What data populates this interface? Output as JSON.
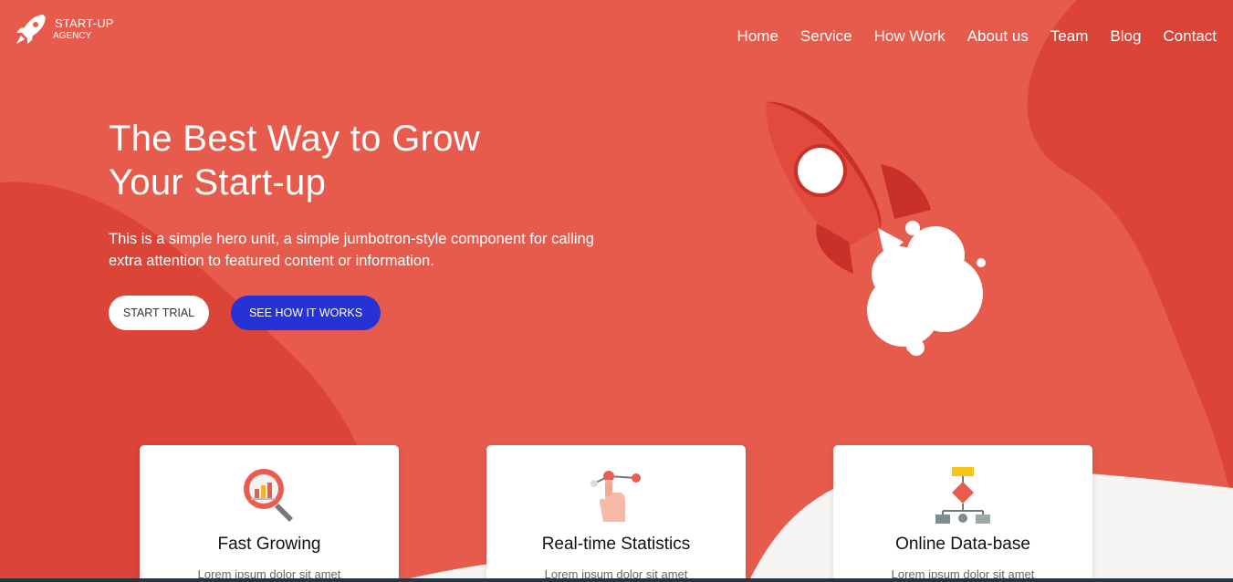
{
  "brand": {
    "title": "START-UP",
    "subtitle": "AGENCY"
  },
  "nav": [
    "Home",
    "Service",
    "How Work",
    "About us",
    "Team",
    "Blog",
    "Contact"
  ],
  "hero": {
    "title_line1": "The Best Way to Grow",
    "title_line2": "Your Start-up",
    "text": "This is a simple hero unit, a simple jumbotron-style component for calling extra attention to featured content or information.",
    "btn_trial": "START TRIAL",
    "btn_how": "SEE HOW IT WORKS"
  },
  "cards": [
    {
      "title": "Fast Growing",
      "text": "Lorem ipsum dolor sit amet",
      "icon": "magnifier-chart-icon"
    },
    {
      "title": "Real-time Statistics",
      "text": "Lorem ipsum dolor sit amet",
      "icon": "hand-graph-icon"
    },
    {
      "title": "Online Data-base",
      "text": "Lorem ipsum dolor sit amet",
      "icon": "database-network-icon"
    }
  ],
  "colors": {
    "primary_bg": "#e75b4c",
    "dark_wave": "#dc4438",
    "button_blue": "#2631d6",
    "white": "#ffffff"
  }
}
